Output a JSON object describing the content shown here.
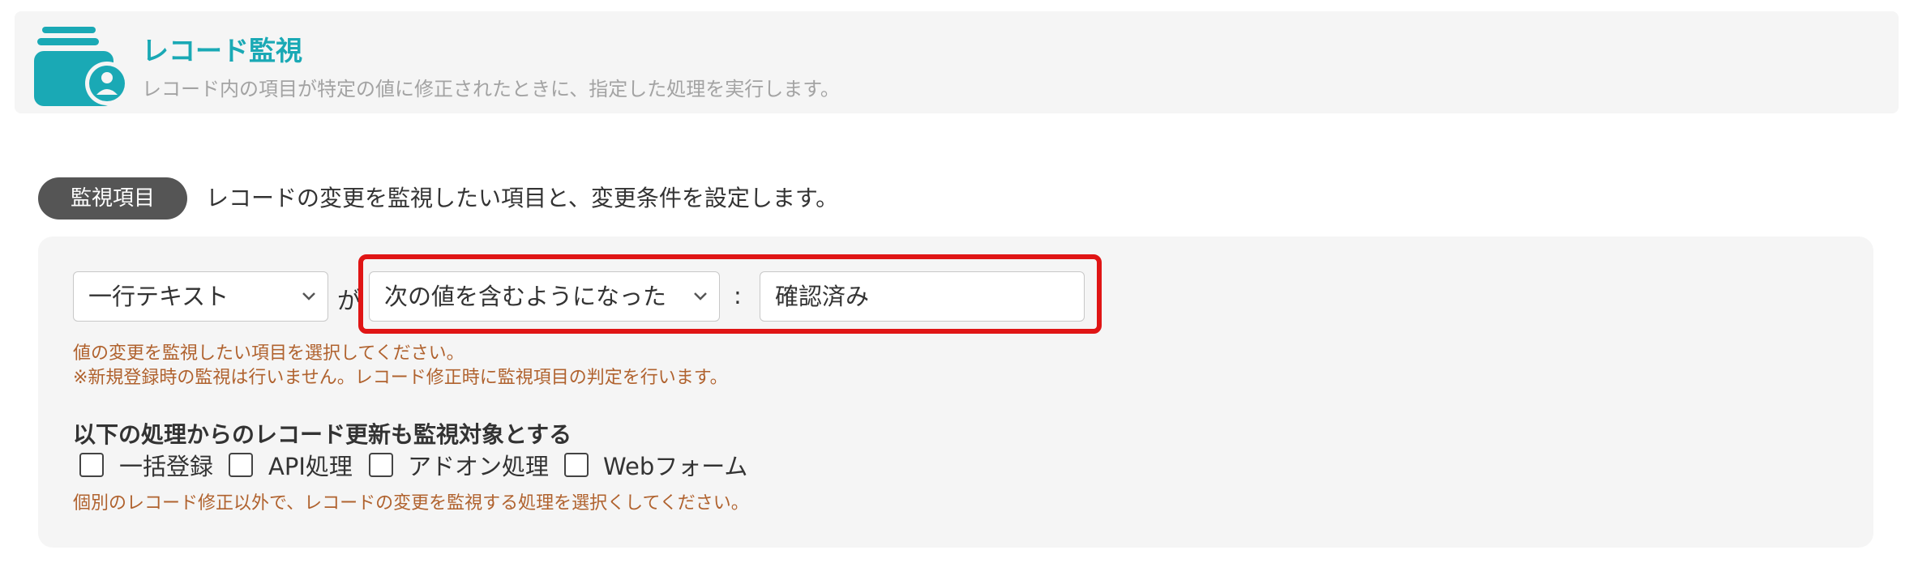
{
  "header": {
    "icon": "record-monitor-icon",
    "title": "レコード監視",
    "description": "レコード内の項目が特定の値に修正されたときに、指定した処理を実行します。"
  },
  "section": {
    "badge": "監視項目",
    "description": "レコードの変更を監視したい項目と、変更条件を設定します。"
  },
  "condition": {
    "field_select": "一行テキスト",
    "connector": "が",
    "condition_select": "次の値を含むようになった",
    "separator": ":",
    "value_input": "確認済み"
  },
  "hints": {
    "line1": "値の変更を監視したい項目を選択してください。",
    "line2": "※新規登録時の監視は行いません。レコード修正時に監視項目の判定を行います。"
  },
  "also_monitor": {
    "title": "以下の処理からのレコード更新も監視対象とする",
    "options": [
      {
        "label": "一括登録",
        "checked": false
      },
      {
        "label": "API処理",
        "checked": false
      },
      {
        "label": "アドオン処理",
        "checked": false
      },
      {
        "label": "Webフォーム",
        "checked": false
      }
    ],
    "hint": "個別のレコード修正以外で、レコードの変更を監視する処理を選択くしてください。"
  },
  "colors": {
    "accent": "#1aa9b5",
    "highlight": "#e01515",
    "hint": "#b0622e",
    "badge_bg": "#555555"
  }
}
